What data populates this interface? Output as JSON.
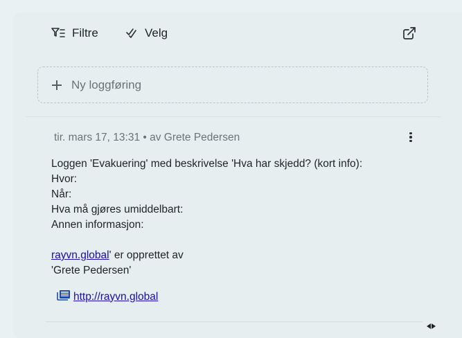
{
  "toolbar": {
    "filter_label": "Filtre",
    "filter_icon": "filter-icon",
    "select_label": "Velg",
    "select_icon": "double-check-icon",
    "external_icon": "open-external-icon"
  },
  "new_entry": {
    "placeholder": "Ny loggføring",
    "icon": "plus-icon"
  },
  "entry": {
    "meta": "tir. mars 17, 13:31 • av Grete Pedersen",
    "menu_icon": "kebab-menu-icon",
    "lines": [
      "Loggen 'Evakuering' med beskrivelse 'Hva har skjedd? (kort info):",
      "Hvor:",
      "Når:",
      "Hva må gjøres umiddelbart:",
      "Annen informasjon:",
      ""
    ],
    "link_text": "rayvn.global",
    "link_suffix": "' er opprettet av",
    "last_line": "'Grete Pedersen'",
    "attachment": {
      "icon": "link-card-icon",
      "text": "http://rayvn.global"
    }
  },
  "colors": {
    "background": "#eaf1f2",
    "link": "#1a0dab",
    "muted_text": "#6b7378"
  }
}
